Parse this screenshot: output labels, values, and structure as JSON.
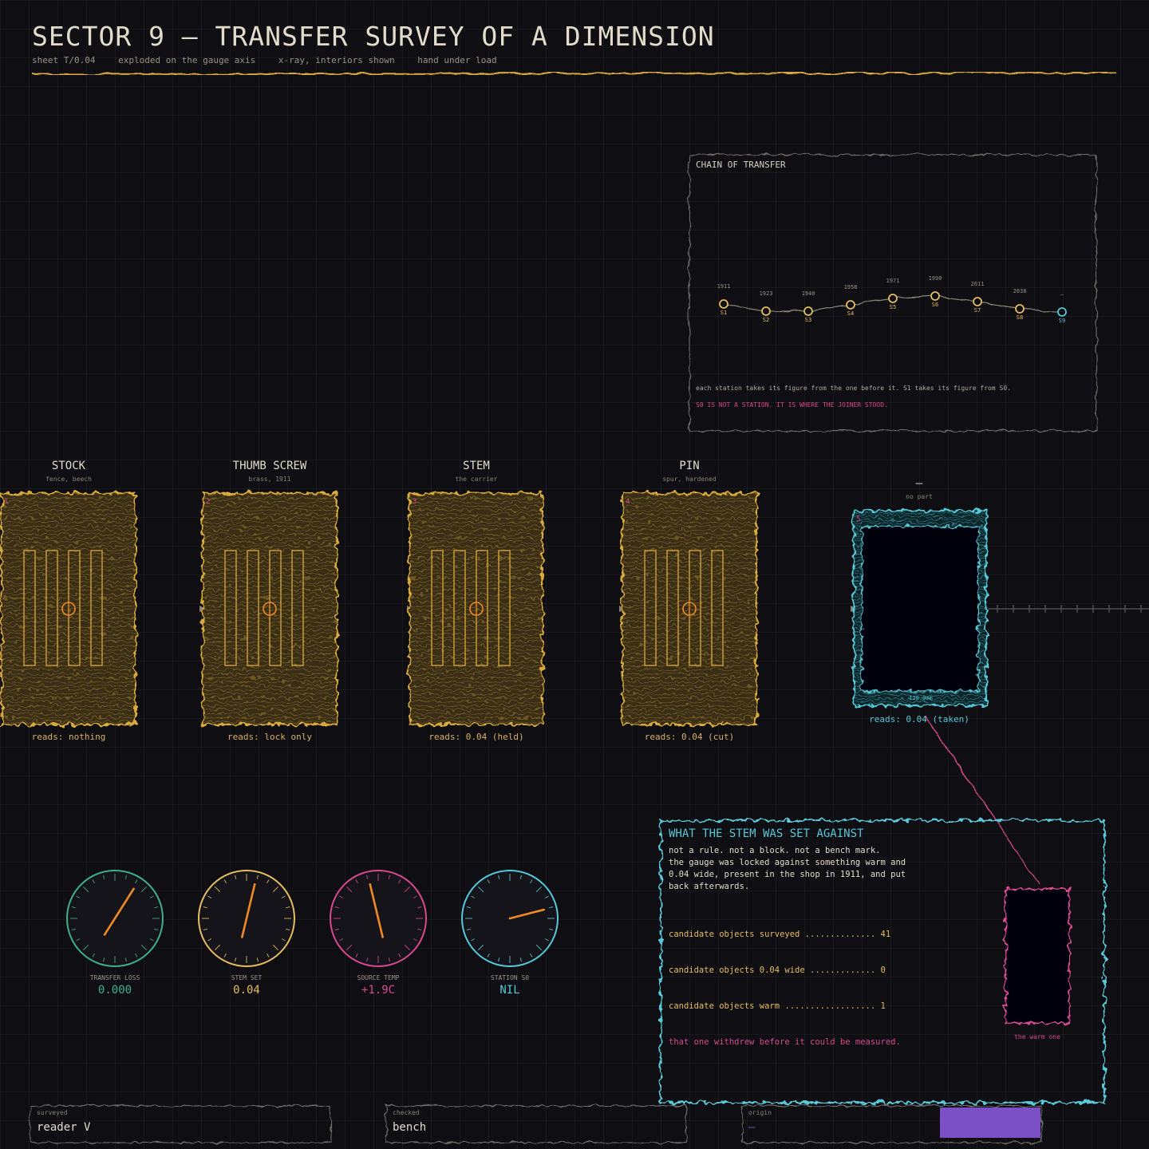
{
  "header": {
    "title": "SECTOR 9 — TRANSFER SURVEY OF A DIMENSION",
    "subtitle_items": [
      "sheet T/0.04",
      "exploded on the gauge axis",
      "x-ray, interiors shown",
      "hand under load"
    ]
  },
  "chain": {
    "title": "CHAIN OF TRANSFER",
    "stations": [
      {
        "id": "S1",
        "year": "1911"
      },
      {
        "id": "S2",
        "year": "1923"
      },
      {
        "id": "S3",
        "year": "1940"
      },
      {
        "id": "S4",
        "year": "1958"
      },
      {
        "id": "S5",
        "year": "1971"
      },
      {
        "id": "S6",
        "year": "1990"
      },
      {
        "id": "S7",
        "year": "2011"
      },
      {
        "id": "S8",
        "year": "2038"
      },
      {
        "id": "S9",
        "year": "—"
      }
    ],
    "note": "each station takes its figure from the one before it.  S1 takes its figure from S0.",
    "warning": "S0 IS NOT A STATION. IT IS WHERE THE JOINER STOOD."
  },
  "parts": [
    {
      "num": "1",
      "name": "STOCK",
      "sub": "fence, beech",
      "reads": "reads: nothing"
    },
    {
      "num": "2",
      "name": "THUMB SCREW",
      "sub": "brass, 1911",
      "reads": "reads: lock only"
    },
    {
      "num": "3",
      "name": "STEM",
      "sub": "the carrier",
      "reads": "reads: 0.04 (held)"
    },
    {
      "num": "4",
      "name": "PIN",
      "sub": "spur, hardened",
      "reads": "reads: 0.04 (cut)"
    },
    {
      "num": "5",
      "name": "—",
      "sub": "no part",
      "reads": "reads: 0.04 (taken)",
      "dimension": "120.0mm"
    }
  ],
  "gauges": [
    {
      "label": "TRANSFER LOSS",
      "value": "0.000",
      "color": "#3fb08a",
      "level": 0.62
    },
    {
      "label": "STEM SET",
      "value": "0.04",
      "color": "#e6bd62",
      "level": 0.55
    },
    {
      "label": "SOURCE TEMP",
      "value": "+1.9C",
      "color": "#d9498f",
      "level": 0.45
    },
    {
      "label": "STATION S0",
      "value": "NIL",
      "color": "#56c8d8",
      "level": 0.78
    }
  ],
  "stem_panel": {
    "title": "WHAT THE STEM WAS SET AGAINST",
    "lines": [
      "not a rule.  not a block.  not a bench mark.",
      "the gauge was locked against something warm and",
      "0.04 wide, present in the shop in 1911, and put",
      "back afterwards."
    ],
    "stats": [
      {
        "text": "candidate objects surveyed .............. 41"
      },
      {
        "text": "candidate objects 0.04 wide ............. 0"
      },
      {
        "text": "candidate objects warm .................. 1"
      }
    ],
    "conclusion": "that one withdrew before it could be measured.",
    "warm_label": "the warm one"
  },
  "footer": {
    "fields": [
      {
        "label": "surveyed",
        "value": "reader V"
      },
      {
        "label": "checked",
        "value": "bench"
      },
      {
        "label": "origin",
        "value": "—"
      }
    ],
    "swatch_color": "#7b4fc6"
  },
  "colors": {
    "amber": "#d9a93a",
    "cyan": "#56c8d8",
    "magenta": "#d9498f",
    "purple": "#7b4fc6"
  }
}
